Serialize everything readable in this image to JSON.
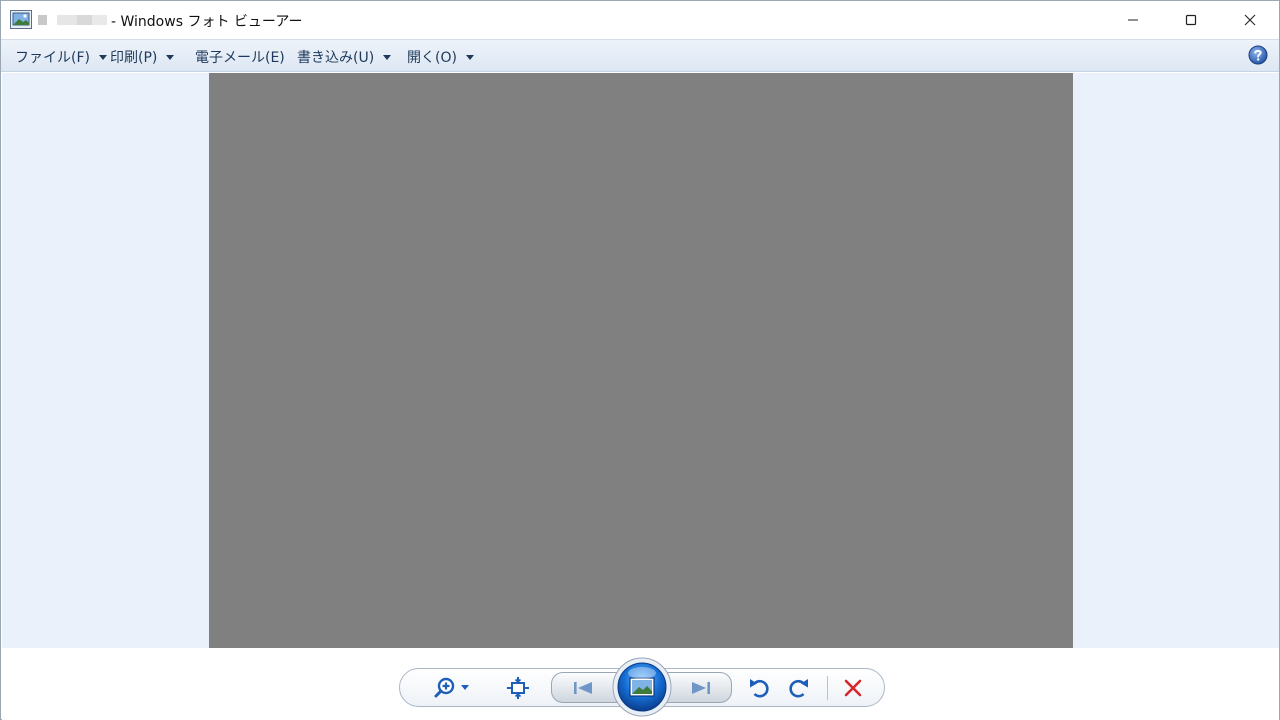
{
  "window": {
    "title": "- Windows フォト ビューアー"
  },
  "menu": {
    "items": [
      {
        "label": "ファイル(F)",
        "has_dropdown": true
      },
      {
        "label": "印刷(P)",
        "has_dropdown": true
      },
      {
        "label": "電子メール(E)",
        "has_dropdown": false
      },
      {
        "label": "書き込み(U)",
        "has_dropdown": true
      },
      {
        "label": "開く(O)",
        "has_dropdown": true
      }
    ],
    "help_icon": "help-icon"
  },
  "viewer": {
    "photo_color": "#808080",
    "background_color": "#eaf1fb"
  },
  "controls": {
    "icons": [
      "zoom-icon",
      "fit-to-window-icon",
      "previous-icon",
      "slideshow-icon",
      "next-icon",
      "rotate-left-icon",
      "rotate-right-icon",
      "delete-icon"
    ]
  },
  "colors": {
    "menu_text": "#1e395b",
    "accent_blue": "#1d5fb8",
    "delete_red": "#d9262a"
  }
}
